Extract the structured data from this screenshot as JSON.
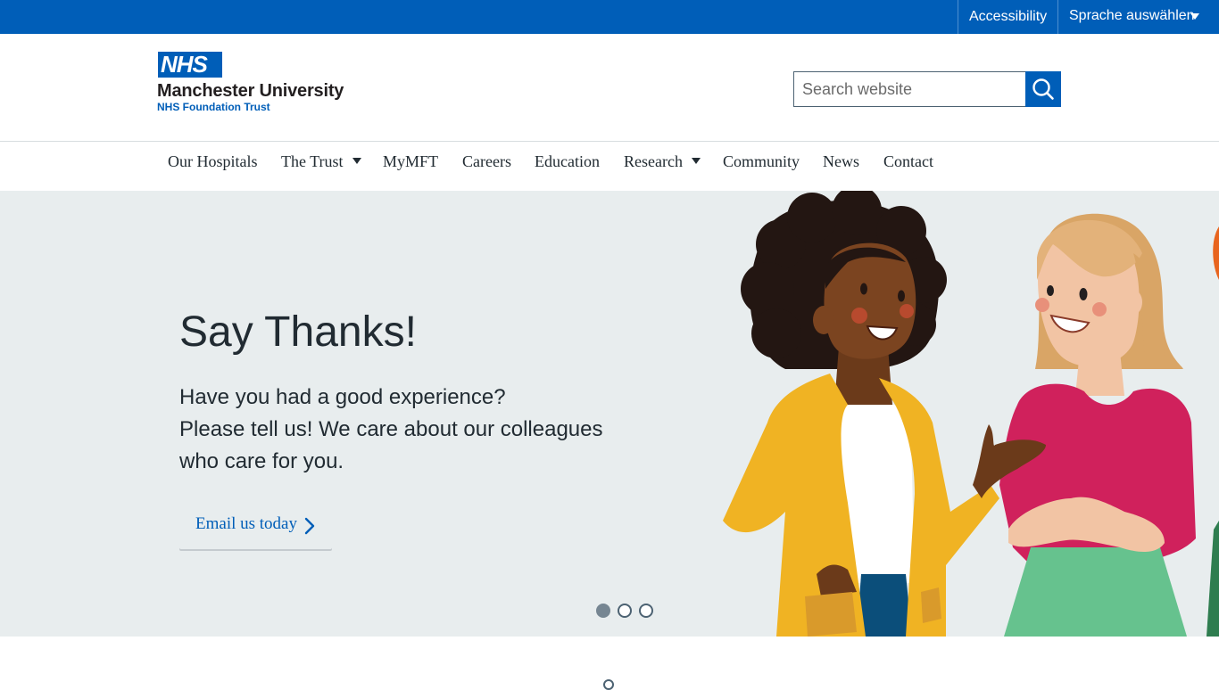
{
  "topbar": {
    "accessibility_label": "Accessibility",
    "language_label": "Sprache auswählen"
  },
  "header": {
    "logo": {
      "nhs": "NHS",
      "organisation": "Manchester University",
      "trust": "NHS Foundation Trust"
    },
    "search": {
      "placeholder": "Search website",
      "button_icon": "search-icon"
    }
  },
  "nav": {
    "items": [
      {
        "label": "Our Hospitals",
        "dropdown": false
      },
      {
        "label": "The Trust",
        "dropdown": true
      },
      {
        "label": "MyMFT",
        "dropdown": false
      },
      {
        "label": "Careers",
        "dropdown": false
      },
      {
        "label": "Education",
        "dropdown": false
      },
      {
        "label": "Research",
        "dropdown": true
      },
      {
        "label": "Community",
        "dropdown": false
      },
      {
        "label": "News",
        "dropdown": false
      },
      {
        "label": "Contact",
        "dropdown": false
      }
    ]
  },
  "hero": {
    "title": "Say Thanks!",
    "body_lines": [
      "Have you had a good experience?",
      "Please tell us! We care about our colleagues",
      "who care for you."
    ],
    "cta_label": "Email us today",
    "carousel": {
      "slides": 3,
      "active": 1
    }
  },
  "colors": {
    "nhs_blue": "#005eb8",
    "hero_bg": "#e8edee",
    "text": "#212b32"
  }
}
